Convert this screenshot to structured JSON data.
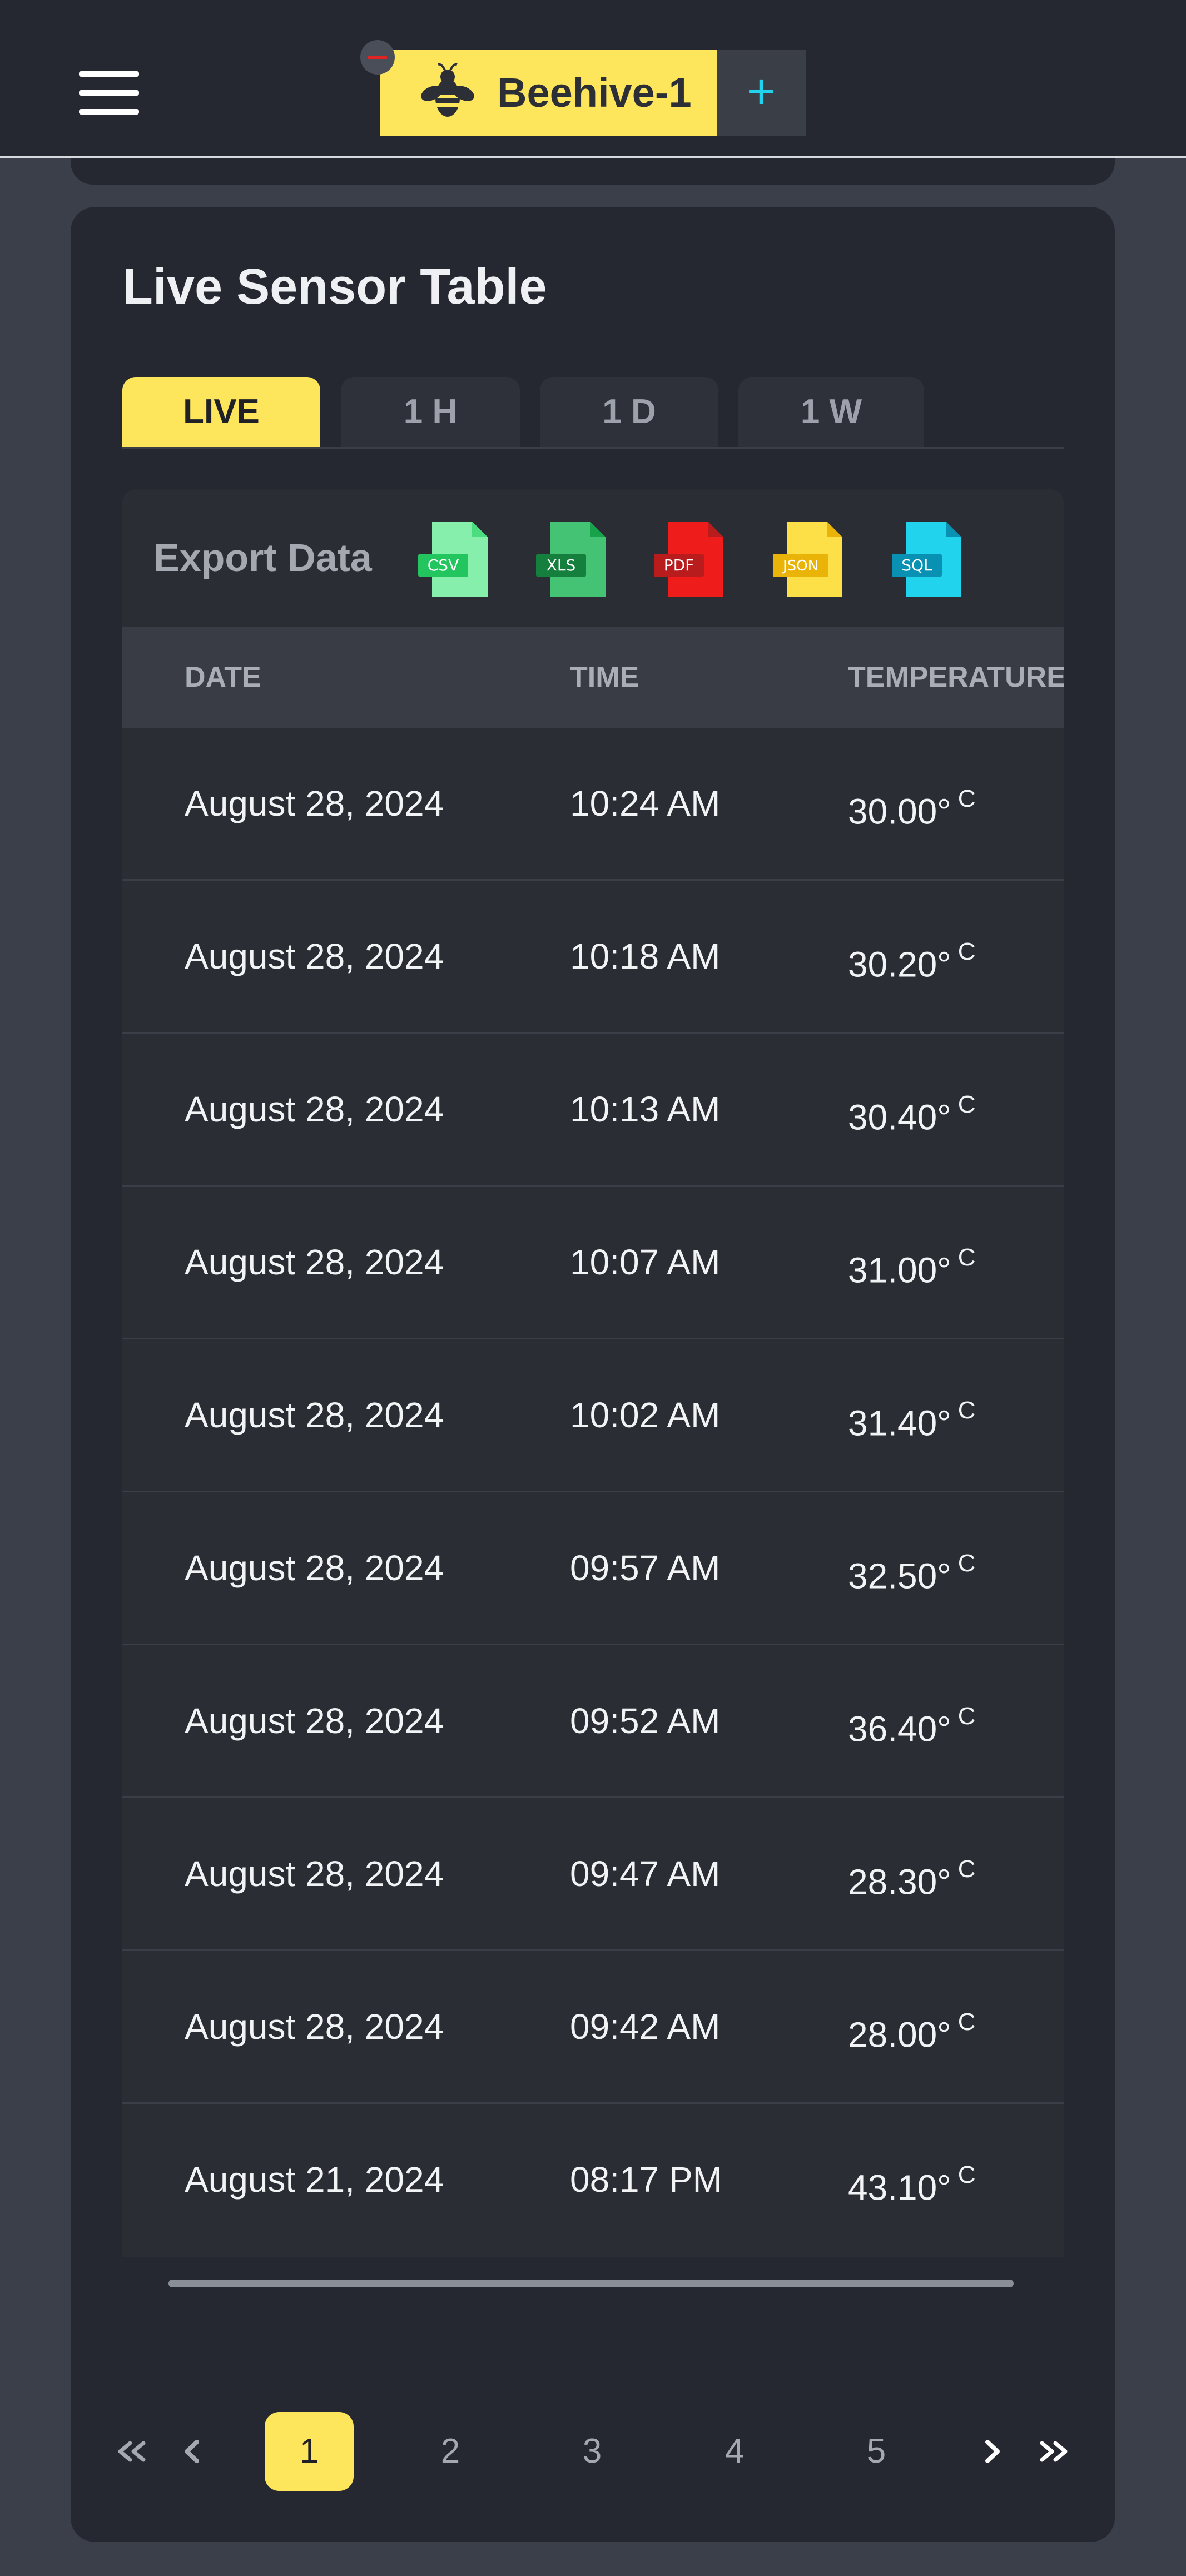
{
  "header": {
    "hive_name": "Beehive-1",
    "add_label": "+",
    "accent": "#fde55c"
  },
  "card": {
    "title": "Live Sensor Table",
    "tabs": [
      {
        "label": "LIVE",
        "active": true
      },
      {
        "label": "1 H",
        "active": false
      },
      {
        "label": "1 D",
        "active": false
      },
      {
        "label": "1 W",
        "active": false
      }
    ]
  },
  "export": {
    "label": "Export Data",
    "formats": [
      {
        "label": "CSV",
        "color": "#86efac",
        "badge": "#22c55e"
      },
      {
        "label": "XLS",
        "color": "#4ade80",
        "badge": "#15803d"
      },
      {
        "label": "PDF",
        "color": "#ef4444",
        "badge": "#b91c1c"
      },
      {
        "label": "JSON",
        "color": "#fde047",
        "badge": "#eab308"
      },
      {
        "label": "SQL",
        "color": "#22d3ee",
        "badge": "#0891b2"
      }
    ]
  },
  "table": {
    "columns": [
      "DATE",
      "TIME",
      "TEMPERATURE"
    ],
    "unit": "C",
    "rows": [
      {
        "date": "August 28, 2024",
        "time": "10:24 AM",
        "temp": "30.00°"
      },
      {
        "date": "August 28, 2024",
        "time": "10:18 AM",
        "temp": "30.20°"
      },
      {
        "date": "August 28, 2024",
        "time": "10:13 AM",
        "temp": "30.40°"
      },
      {
        "date": "August 28, 2024",
        "time": "10:07 AM",
        "temp": "31.00°"
      },
      {
        "date": "August 28, 2024",
        "time": "10:02 AM",
        "temp": "31.40°"
      },
      {
        "date": "August 28, 2024",
        "time": "09:57 AM",
        "temp": "32.50°"
      },
      {
        "date": "August 28, 2024",
        "time": "09:52 AM",
        "temp": "36.40°"
      },
      {
        "date": "August 28, 2024",
        "time": "09:47 AM",
        "temp": "28.30°"
      },
      {
        "date": "August 28, 2024",
        "time": "09:42 AM",
        "temp": "28.00°"
      },
      {
        "date": "August 21, 2024",
        "time": "08:17 PM",
        "temp": "43.10°"
      }
    ]
  },
  "pagination": {
    "pages": [
      "1",
      "2",
      "3",
      "4",
      "5"
    ],
    "current": "1"
  }
}
